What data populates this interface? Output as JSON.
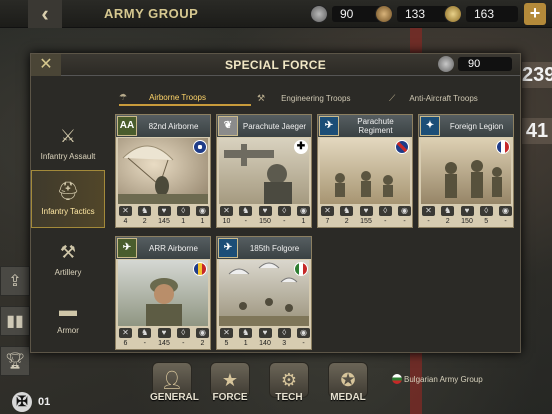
{
  "topbar": {
    "title": "ARMY GROUP",
    "res1": "90",
    "res2": "133",
    "res3": "163",
    "plus": "+",
    "back": "‹"
  },
  "side_numbers": [
    "239",
    "41"
  ],
  "modal": {
    "title": "SPECIAL FORCE",
    "close": "✕",
    "medals": "90",
    "categories": [
      {
        "label": "Infantry Assault",
        "icon": "soldier-assault-icon"
      },
      {
        "label": "Infantry Tactics",
        "icon": "helmet-icon"
      },
      {
        "label": "Artillery",
        "icon": "cannon-icon"
      },
      {
        "label": "Armor",
        "icon": "tank-icon"
      }
    ],
    "tabs": [
      {
        "label": "Airborne Troops"
      },
      {
        "label": "Engineering Troops"
      },
      {
        "label": "Anti-Aircraft Troops"
      }
    ],
    "cards": [
      {
        "name": "82nd Airborne",
        "emblem": "AA",
        "flag": "usa",
        "stats": [
          "4",
          "2",
          "145",
          "1",
          "1"
        ]
      },
      {
        "name": "Parachute Jaeger",
        "emblem": "❦",
        "flag": "germany",
        "stats": [
          "10",
          "-",
          "150",
          "-",
          "1"
        ]
      },
      {
        "name": "Parachute Regiment",
        "emblem": "✈",
        "flag": "uk",
        "stats": [
          "7",
          "2",
          "155",
          "-",
          "-"
        ]
      },
      {
        "name": "Foreign Legion",
        "emblem": "✦",
        "flag": "france",
        "stats": [
          "-",
          "2",
          "150",
          "5",
          "-"
        ]
      },
      {
        "name": "ARR Airborne",
        "emblem": "✈",
        "flag": "romania",
        "stats": [
          "6",
          "-",
          "145",
          "-",
          "2"
        ]
      },
      {
        "name": "185th Folgore",
        "emblem": "✈",
        "flag": "italy",
        "stats": [
          "5",
          "1",
          "140",
          "3",
          "-"
        ]
      }
    ]
  },
  "bottom": {
    "turn": "01",
    "tabs": [
      {
        "label": "GENERAL",
        "icon": "general-icon"
      },
      {
        "label": "FORCE",
        "icon": "force-icon"
      },
      {
        "label": "TECH",
        "icon": "gear-icon"
      },
      {
        "label": "MEDAL",
        "icon": "medal-icon"
      }
    ],
    "map_label": "Bulgarian Army Group"
  }
}
